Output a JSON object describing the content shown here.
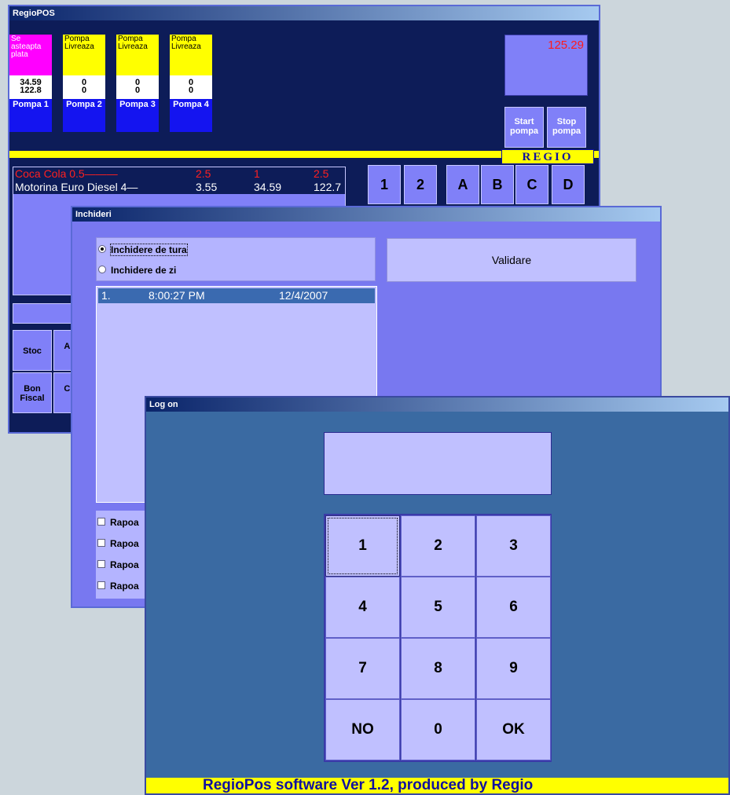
{
  "pos_window": {
    "title": "RegioPOS",
    "pumps": [
      {
        "status": "Se asteapta plata",
        "color": "#ff00ff",
        "v1": "34.59",
        "v2": "122.8",
        "name": "Pompa 1"
      },
      {
        "status": "Pompa Livreaza",
        "color": "#ffff00",
        "v1": "0",
        "v2": "0",
        "name": "Pompa 2"
      },
      {
        "status": "Pompa Livreaza",
        "color": "#ffff00",
        "v1": "0",
        "v2": "0",
        "name": "Pompa 3"
      },
      {
        "status": "Pompa Livreaza",
        "color": "#ffff00",
        "v1": "0",
        "v2": "0",
        "name": "Pompa 4"
      }
    ],
    "total": "125.29",
    "start_pump": "Start pompa",
    "stop_pump": "Stop pompa",
    "logo": "REGIO",
    "sales": [
      {
        "product": "Coca Cola 0.5———",
        "price": "2.5",
        "qty": "1",
        "amount": "2.5"
      },
      {
        "product": "Motorina Euro Diesel 4—",
        "price": "3.55",
        "qty": "34.59",
        "amount": "122.7"
      }
    ],
    "numkeys": [
      "1",
      "2",
      "A",
      "B",
      "C",
      "D"
    ],
    "buttons": {
      "stoc": "Stoc",
      "ar_partial": "Ar B",
      "bon_fiscal": "Bon Fiscal",
      "cr_partial": "Cr C"
    }
  },
  "inchideri_window": {
    "title": "Inchideri",
    "radio_shift": "Inchidere de tura",
    "radio_day": "Inchidere de zi",
    "validate": "Validare",
    "shift_entry": {
      "index": "1.",
      "time": "8:00:27 PM",
      "date": "12/4/2007"
    },
    "reports": [
      "Rapoa",
      "Rapoa",
      "Rapoa",
      "Rapoa"
    ]
  },
  "logon_window": {
    "title": "Log on",
    "keys": [
      "1",
      "2",
      "3",
      "4",
      "5",
      "6",
      "7",
      "8",
      "9",
      "NO",
      "0",
      "OK"
    ],
    "footer": "RegioPos software Ver 1.2, produced by Regio"
  },
  "colors": {
    "pos_bg": "#0d1c58",
    "panel": "#8080f8",
    "yellow": "#ffff00",
    "pump_blue": "#1414f0",
    "sale_red": "#ff2020"
  }
}
